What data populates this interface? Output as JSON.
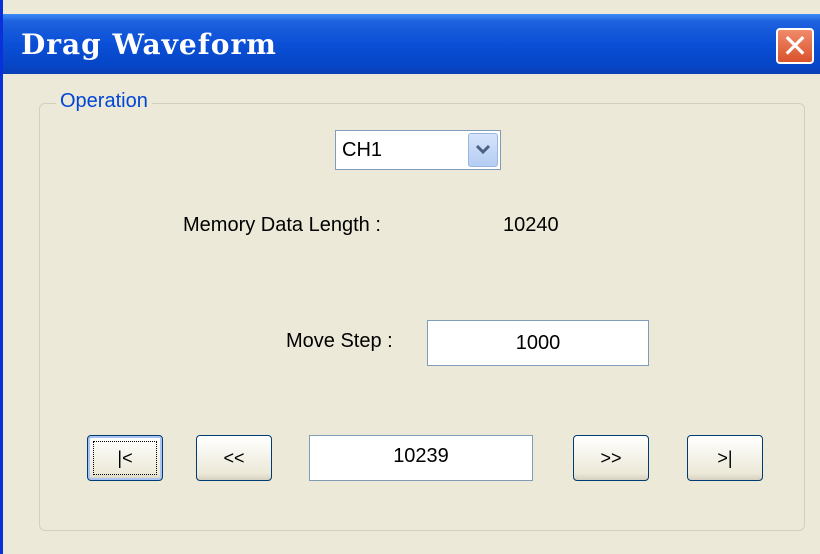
{
  "window": {
    "title": "Drag Waveform",
    "close_symbol": "✕"
  },
  "group": {
    "label": "Operation"
  },
  "channel_select": {
    "value": "CH1"
  },
  "memory": {
    "label": "Memory Data Length :",
    "value": "10240"
  },
  "move_step": {
    "label": "Move Step :",
    "value": "1000"
  },
  "navigation": {
    "first_label": "|<",
    "prev_label": "<<",
    "position_value": "10239",
    "next_label": ">>",
    "last_label": ">|"
  }
}
